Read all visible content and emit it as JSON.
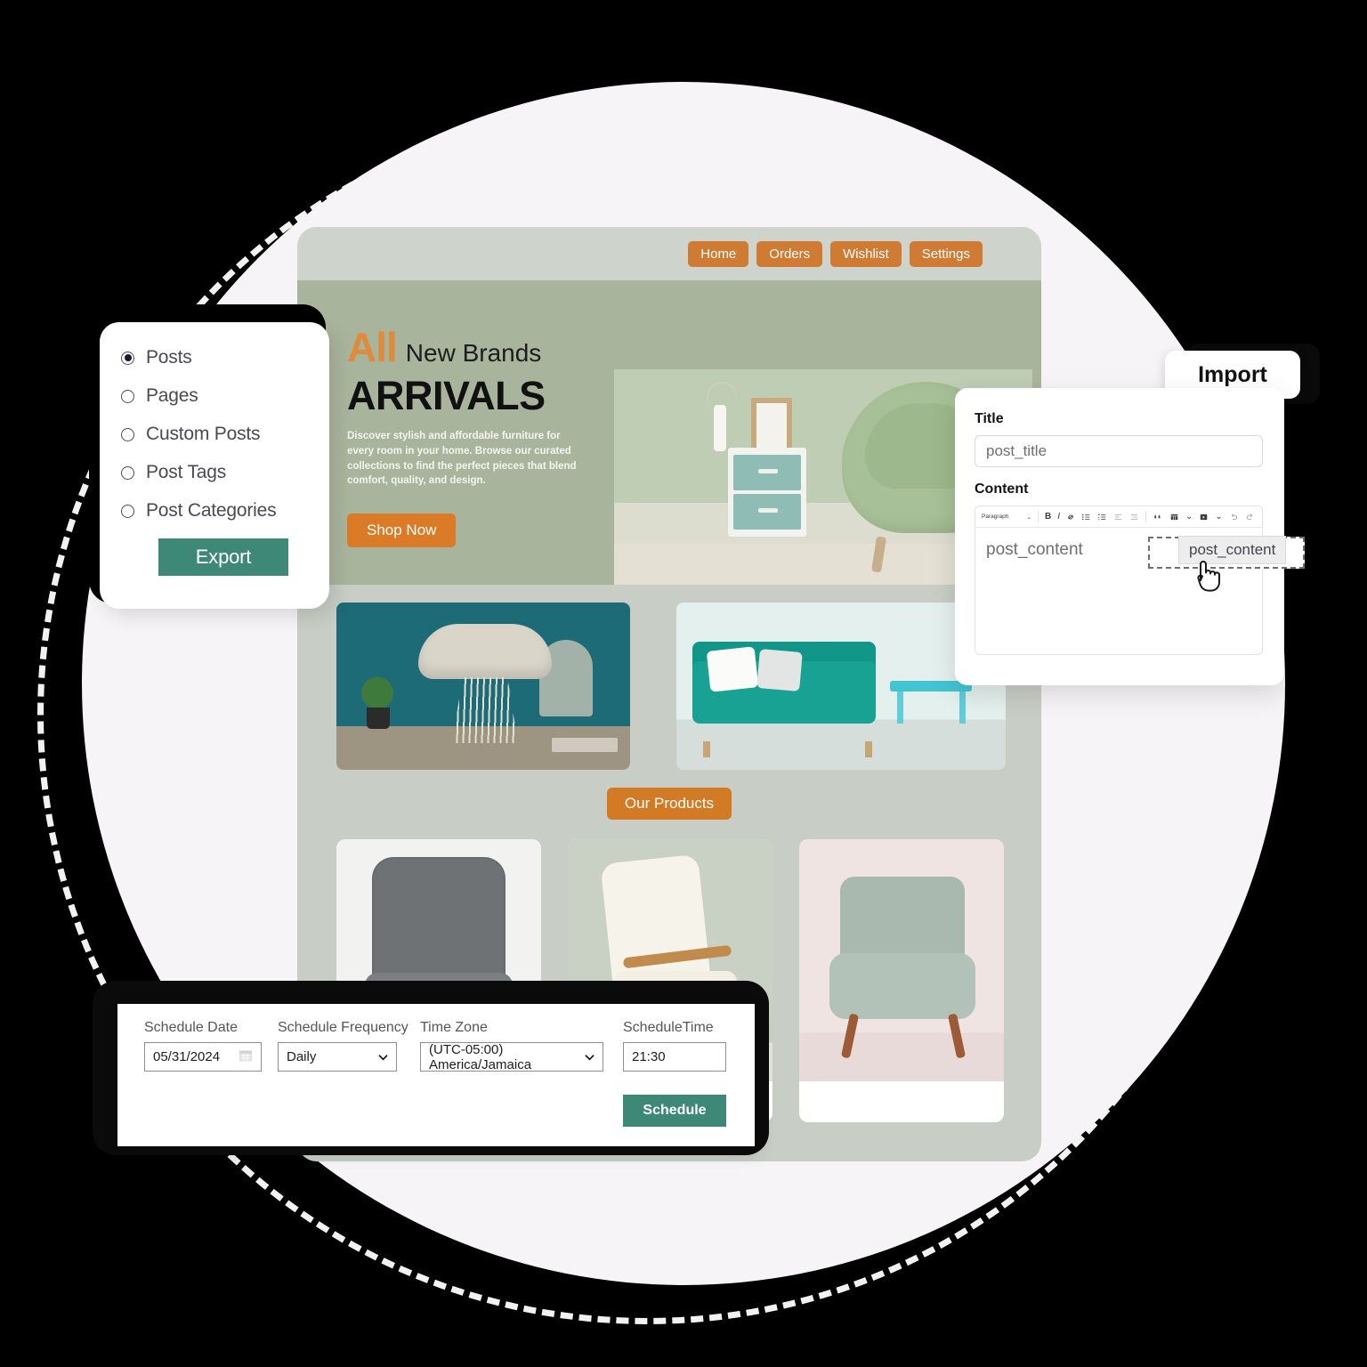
{
  "export_panel": {
    "options": [
      {
        "label": "Posts",
        "selected": true
      },
      {
        "label": "Pages",
        "selected": false
      },
      {
        "label": "Custom Posts",
        "selected": false
      },
      {
        "label": "Post Tags",
        "selected": false
      },
      {
        "label": "Post Categories",
        "selected": false
      }
    ],
    "export_button": "Export",
    "accent_color": "#3D8876"
  },
  "import_panel": {
    "tab_label": "Import",
    "title_label": "Title",
    "title_value": "post_title",
    "content_label": "Content",
    "content_value": "post_content",
    "toolbar": {
      "block_format": "Paragraph",
      "items": [
        "bold-icon",
        "italic-icon",
        "link-icon",
        "bullet-list-icon",
        "numbered-list-icon",
        "align-left-icon",
        "align-right-icon",
        "blockquote-icon",
        "table-icon",
        "media-icon",
        "undo-icon",
        "redo-icon"
      ]
    },
    "drag_chip_label": "post_content"
  },
  "schedule_panel": {
    "fields": [
      {
        "label": "Schedule Date",
        "value": "05/31/2024",
        "type": "date"
      },
      {
        "label": "Schedule Frequency",
        "value": "Daily",
        "type": "select"
      },
      {
        "label": "Time Zone",
        "value": "(UTC-05:00) America/Jamaica",
        "type": "select"
      },
      {
        "label": "ScheduleTime",
        "value": "21:30",
        "type": "text"
      }
    ],
    "schedule_button": "Schedule",
    "accent_color": "#3D8876"
  },
  "website": {
    "nav": [
      {
        "label": "Home"
      },
      {
        "label": "Orders"
      },
      {
        "label": "Wishlist"
      },
      {
        "label": "Settings"
      }
    ],
    "nav_color": "#CF7B33",
    "hero": {
      "kicker_accent": "All",
      "kicker_rest": "New Brands",
      "title": "ARRIVALS",
      "description": "Discover stylish and affordable furniture for every room in your home. Browse our curated collections to find the perfect pieces that blend comfort, quality, and design.",
      "cta": "Shop Now",
      "accent_color": "#DB7B28",
      "background_color": "#A9B49D"
    },
    "products_heading": "Our Products"
  }
}
